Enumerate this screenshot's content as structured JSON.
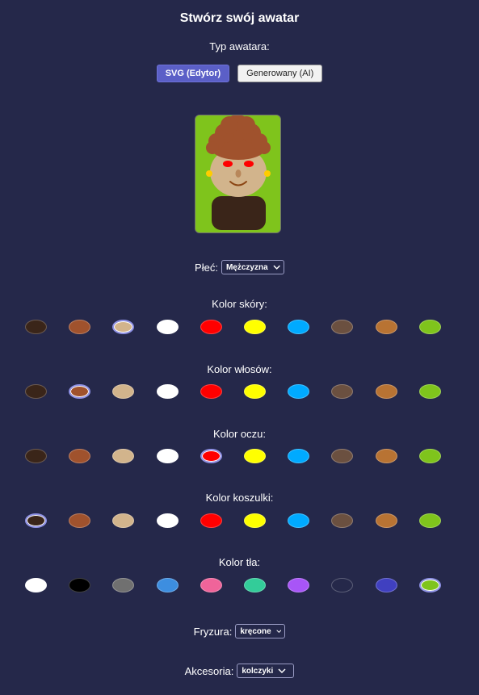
{
  "title": "Stwórz swój awatar",
  "avatar_type": {
    "label": "Typ awatara:",
    "options": [
      {
        "label": "SVG (Edytor)",
        "active": true
      },
      {
        "label": "Generowany (AI)",
        "active": false
      }
    ]
  },
  "gender": {
    "label": "Płeć:",
    "value": "Mężczyzna"
  },
  "palette": [
    "#3a2519",
    "#a0522d",
    "#d2b48c",
    "#ffffff",
    "#ff0000",
    "#ffff00",
    "#00aaff",
    "#6b5040",
    "#b87333",
    "#7fc41c"
  ],
  "background_palette": [
    "#ffffff",
    "#000000",
    "#707070",
    "#3d8ee0",
    "#f0649a",
    "#33cc99",
    "#a855f7",
    "#25284a",
    "#4040c0",
    "#7fc41c"
  ],
  "sections": [
    {
      "label": "Kolor skóry:",
      "selected": 2
    },
    {
      "label": "Kolor włosów:",
      "selected": 1
    },
    {
      "label": "Kolor oczu:",
      "selected": 4
    },
    {
      "label": "Kolor koszulki:",
      "selected": 0
    },
    {
      "label": "Kolor tła:",
      "selected": 9
    }
  ],
  "hairstyle": {
    "label": "Fryzura:",
    "value": "kręcone"
  },
  "accessories": {
    "label": "Akcesoria:",
    "value": "kolczyki"
  },
  "avatar": {
    "skin": "#d2b48c",
    "hair": "#a0522d",
    "eyes": "#ff0000",
    "shirt": "#3a2519",
    "background": "#7fc41c",
    "earrings": "#ffcc00"
  }
}
